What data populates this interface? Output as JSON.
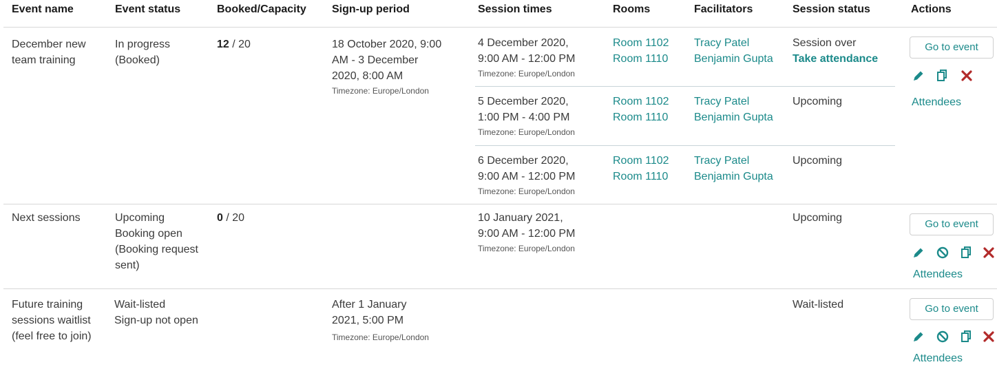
{
  "headers": [
    "Event name",
    "Event status",
    "Booked/Capacity",
    "Sign-up period",
    "Session times",
    "Rooms",
    "Facilitators",
    "Session status",
    "Actions"
  ],
  "rows": [
    {
      "name": [
        "December new",
        "team training"
      ],
      "status": [
        "In progress",
        "(Booked)"
      ],
      "booked": "12",
      "capacity": " / 20",
      "signup": [
        "18 October 2020, 9:00",
        "AM - 3 December",
        "2020, 8:00 AM"
      ],
      "signup_tz": "Timezone: Europe/London",
      "sessions": [
        {
          "time": [
            "4 December 2020,",
            "9:00 AM - 12:00 PM"
          ],
          "tz": "Timezone: Europe/London",
          "rooms": [
            "Room 1102",
            "Room 1110"
          ],
          "facilitators": [
            "Tracy Patel",
            "Benjamin Gupta"
          ],
          "status": "Session over",
          "status_link": "Take attendance"
        },
        {
          "time": [
            "5 December 2020,",
            "1:00 PM - 4:00 PM"
          ],
          "tz": "Timezone: Europe/London",
          "rooms": [
            "Room 1102",
            "Room 1110"
          ],
          "facilitators": [
            "Tracy Patel",
            "Benjamin Gupta"
          ],
          "status": "Upcoming"
        },
        {
          "time": [
            "6 December 2020,",
            "9:00 AM - 12:00 PM"
          ],
          "tz": "Timezone: Europe/London",
          "rooms": [
            "Room 1102",
            "Room 1110"
          ],
          "facilitators": [
            "Tracy Patel",
            "Benjamin Gupta"
          ],
          "status": "Upcoming"
        }
      ],
      "actions": {
        "button": "Go to event",
        "attendees": "Attendees",
        "icons": [
          "edit-icon",
          "copy-icon",
          "delete-icon"
        ]
      }
    },
    {
      "name": [
        "Next sessions"
      ],
      "status": [
        "Upcoming",
        "Booking open",
        "(Booking request",
        "sent)"
      ],
      "booked": "0",
      "capacity": " / 20",
      "sessions": [
        {
          "time": [
            "10 January 2021,",
            "9:00 AM - 12:00 PM"
          ],
          "tz": "Timezone: Europe/London",
          "status": "Upcoming"
        }
      ],
      "actions": {
        "button": "Go to event",
        "attendees": "Attendees",
        "icons": [
          "edit-icon",
          "cancel-icon",
          "copy-icon",
          "delete-icon"
        ]
      }
    },
    {
      "name": [
        "Future training",
        "sessions waitlist",
        "(feel free to join)"
      ],
      "status": [
        "Wait-listed",
        "Sign-up not open"
      ],
      "signup": [
        "After 1 January",
        "2021, 5:00 PM"
      ],
      "signup_tz": "Timezone: Europe/London",
      "sessions": [
        {
          "status": "Wait-listed"
        }
      ],
      "actions": {
        "button": "Go to event",
        "attendees": "Attendees",
        "icons": [
          "edit-icon",
          "cancel-icon",
          "copy-icon",
          "delete-icon"
        ]
      }
    }
  ],
  "colors": {
    "link": "#1b8a8a",
    "delete": "#b22a2a",
    "header": "#1a1a1a"
  }
}
